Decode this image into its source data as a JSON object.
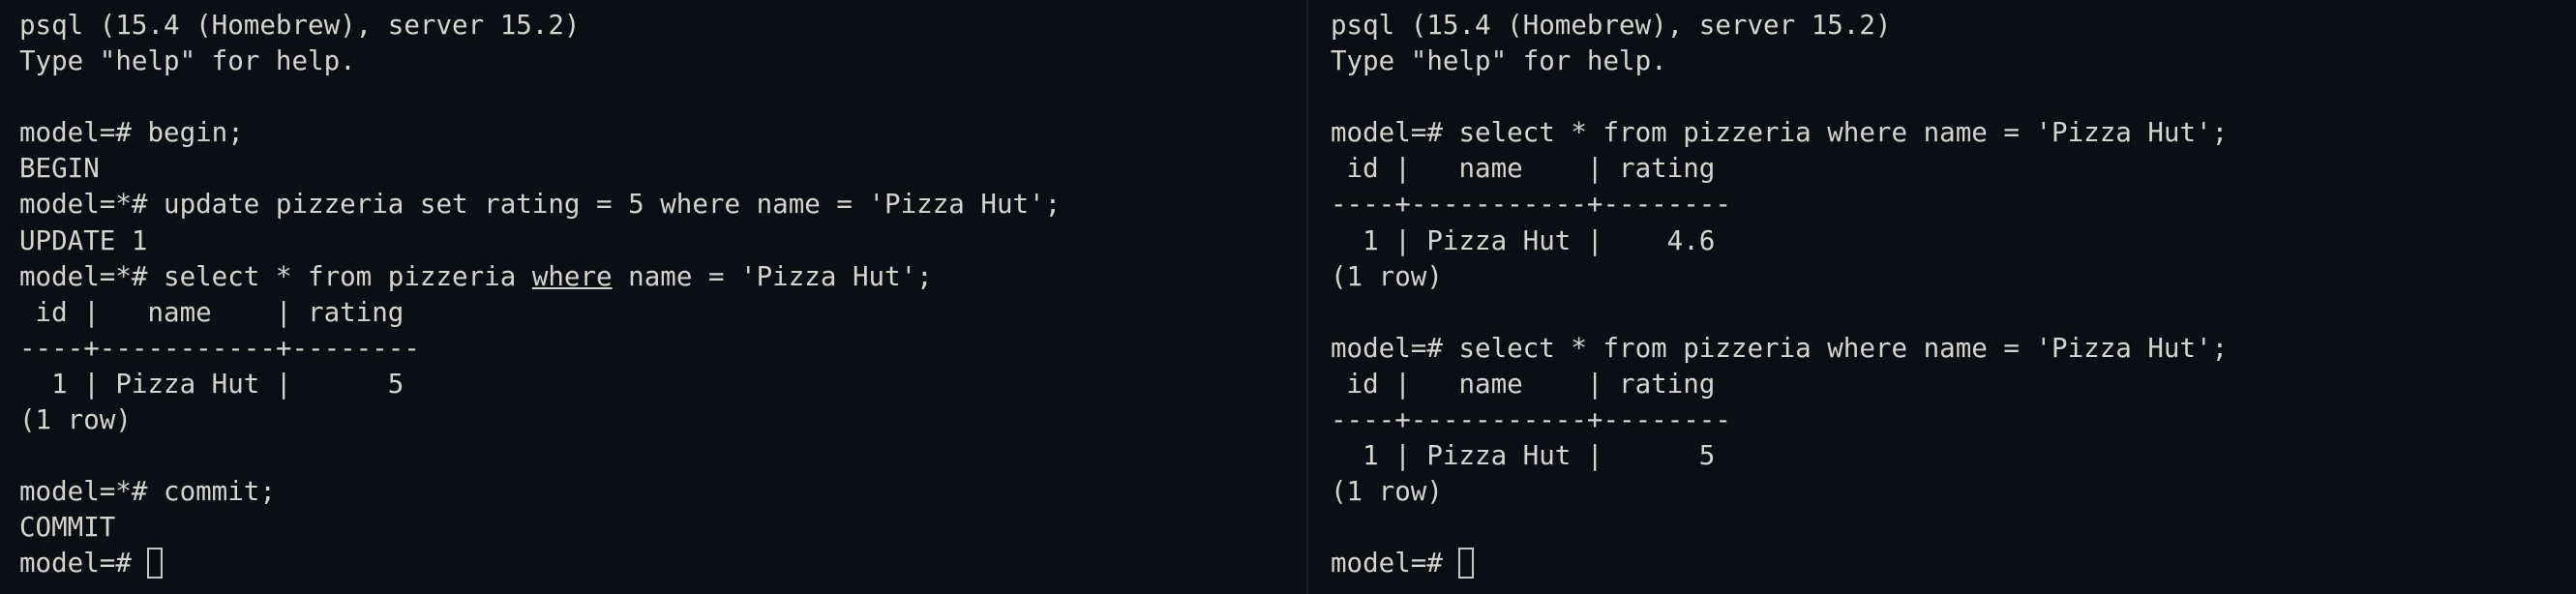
{
  "left_pane": {
    "lines": [
      "psql (15.4 (Homebrew), server 15.2)",
      "Type \"help\" for help.",
      "",
      "model=# begin;",
      "BEGIN",
      "model=*# update pizzeria set rating = 5 where name = 'Pizza Hut';",
      "UPDATE 1",
      "",
      " id |   name    | rating",
      "----+-----------+--------",
      "  1 | Pizza Hut |      5",
      "(1 row)",
      "",
      "model=*# commit;",
      "COMMIT"
    ],
    "select_line": {
      "before": "model=*# select * from pizzeria ",
      "underlined": "where",
      "after": " name = 'Pizza Hut';"
    },
    "prompt": "model=# "
  },
  "right_pane": {
    "lines": [
      "psql (15.4 (Homebrew), server 15.2)",
      "Type \"help\" for help.",
      "",
      "model=# select * from pizzeria where name = 'Pizza Hut';",
      " id |   name    | rating",
      "----+-----------+--------",
      "  1 | Pizza Hut |    4.6",
      "(1 row)",
      "",
      "model=# select * from pizzeria where name = 'Pizza Hut';",
      " id |   name    | rating",
      "----+-----------+--------",
      "  1 | Pizza Hut |      5",
      "(1 row)",
      ""
    ],
    "prompt": "model=# "
  },
  "colors": {
    "background": "#0b0e15",
    "text": "#d4d4cc",
    "divider": "#1c212b"
  }
}
